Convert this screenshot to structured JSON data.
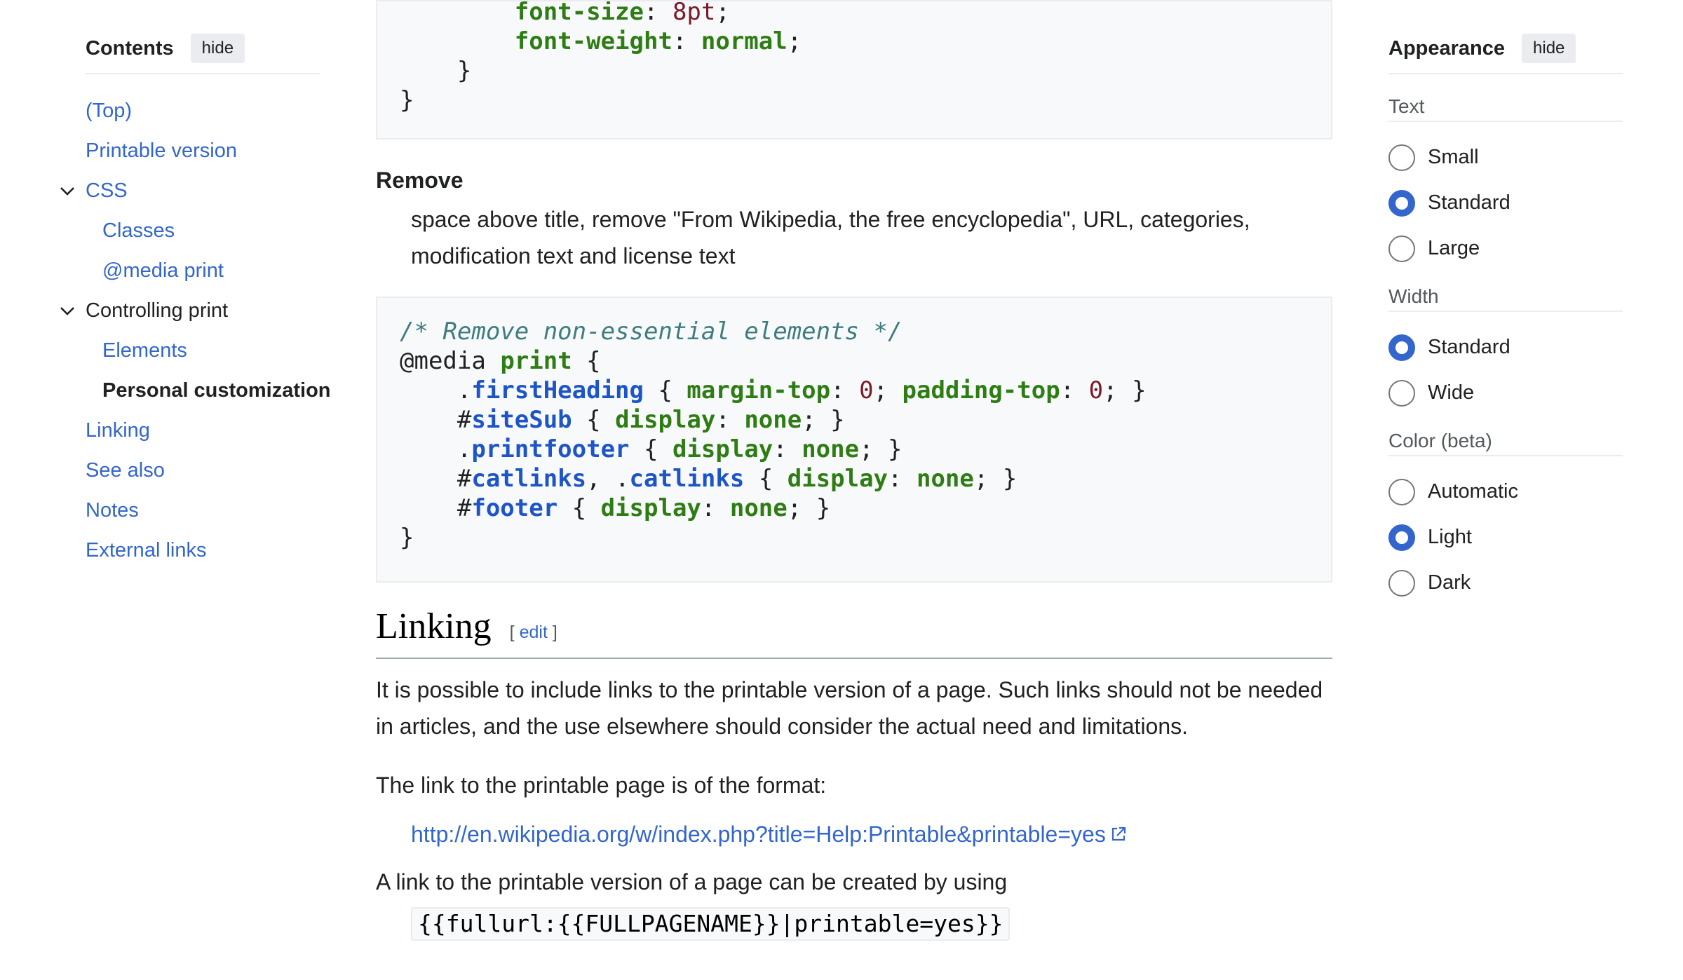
{
  "toc": {
    "title": "Contents",
    "hide_label": "hide",
    "items": [
      {
        "label": "(Top)",
        "level": 1
      },
      {
        "label": "Printable version",
        "level": 1
      },
      {
        "label": "CSS",
        "level": 1,
        "expandable": true
      },
      {
        "label": "Classes",
        "level": 2
      },
      {
        "label": "@media print",
        "level": 2
      },
      {
        "label": "Controlling print",
        "level": 1,
        "expandable": true
      },
      {
        "label": "Elements",
        "level": 2
      },
      {
        "label": "Personal customization",
        "level": 2,
        "active": true
      },
      {
        "label": "Linking",
        "level": 1
      },
      {
        "label": "See also",
        "level": 1
      },
      {
        "label": "Notes",
        "level": 1
      },
      {
        "label": "External links",
        "level": 1
      }
    ]
  },
  "main": {
    "code1": {
      "l1_prop": "font-size",
      "l1_val": "8pt",
      "l2_prop": "font-weight",
      "l2_val": "normal"
    },
    "remove": {
      "term": "Remove",
      "description": "space above title, remove \"From Wikipedia, the free encyclopedia\", URL, categories, modification text and license text"
    },
    "code2": {
      "comment": "/* Remove non-essential elements */",
      "media": "@media",
      "print": "print",
      "first_heading": "firstHeading",
      "margin_top": "margin-top",
      "padding_top": "padding-top",
      "zero": "0",
      "site_sub": "siteSub",
      "display": "display",
      "none": "none",
      "printfooter": "printfooter",
      "catlinks": "catlinks",
      "footer": "footer"
    },
    "linking": {
      "heading": "Linking",
      "edit_label": "edit",
      "para1": "It is possible to include links to the printable version of a page. Such links should not be needed in articles, and the use elsewhere should consider the actual need and limitations.",
      "para2": "The link to the printable page is of the format:",
      "url": "http://en.wikipedia.org/w/index.php?title=Help:Printable&printable=yes",
      "para3": "A link to the printable version of a page can be created by using",
      "code": "{{fullurl:{{FULLPAGENAME}}|printable=yes}}"
    }
  },
  "appearance": {
    "title": "Appearance",
    "hide_label": "hide",
    "groups": [
      {
        "title": "Text",
        "options": [
          "Small",
          "Standard",
          "Large"
        ],
        "selected": "Standard"
      },
      {
        "title": "Width",
        "options": [
          "Standard",
          "Wide"
        ],
        "selected": "Standard"
      },
      {
        "title": "Color (beta)",
        "options": [
          "Automatic",
          "Light",
          "Dark"
        ],
        "selected": "Light"
      }
    ]
  },
  "colors": {
    "link": "#3366cc",
    "keyword": "#2e7d14",
    "selector": "#1d55c9",
    "comment": "#3e7d7f",
    "number": "#7a1a2a",
    "radio_accent": "#3366cc"
  }
}
